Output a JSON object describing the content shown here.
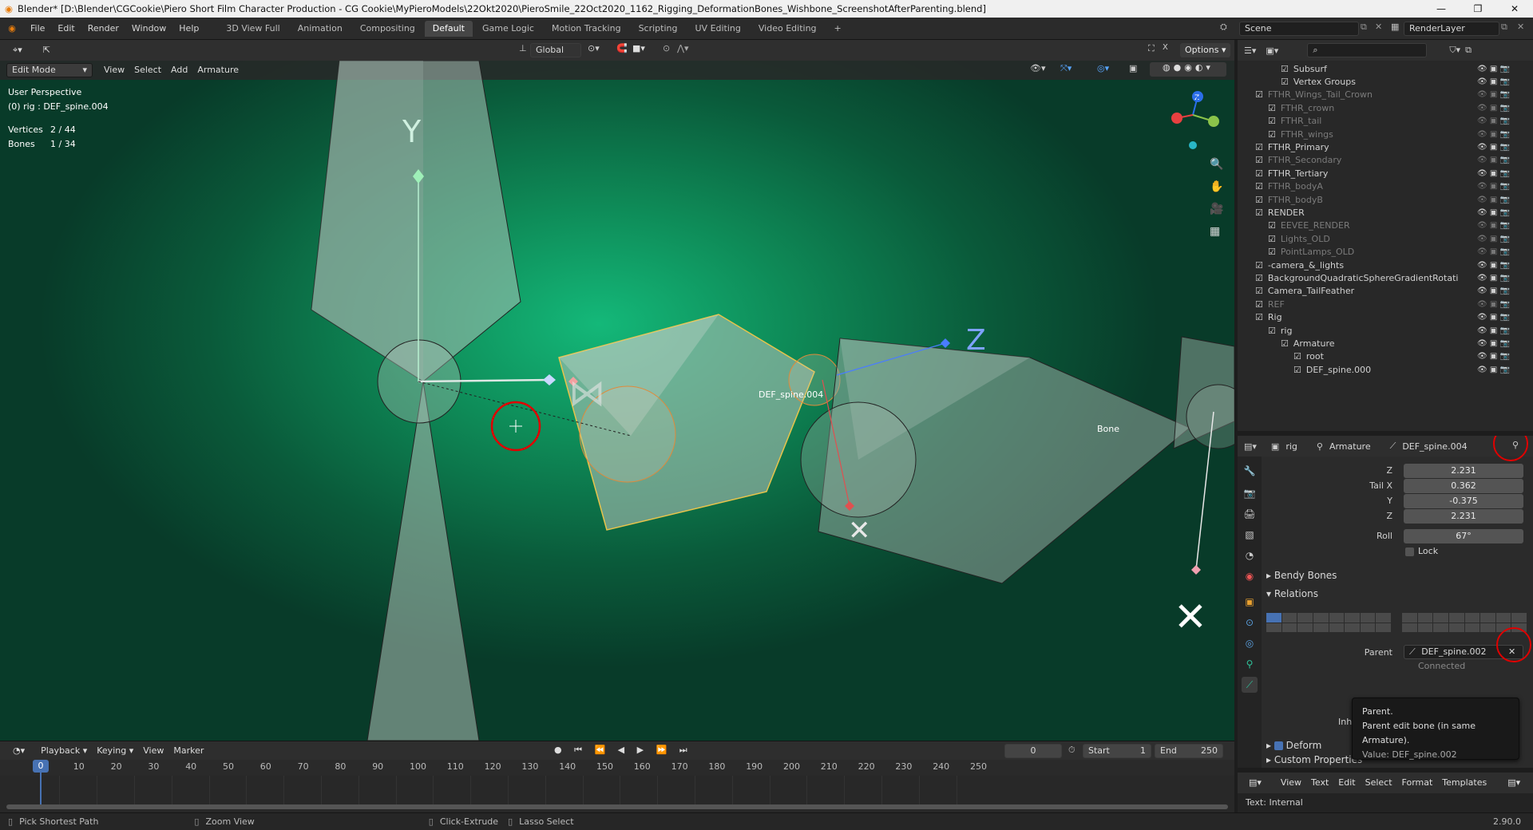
{
  "window": {
    "title": "Blender* [D:\\Blender\\CGCookie\\Piero Short Film Character Production - CG Cookie\\MyPieroModels\\22Okt2020\\PieroSmile_22Oct2020_1162_Rigging_DeformationBones_Wishbone_ScreenshotAfterParenting.blend]",
    "controls": {
      "minimize": "—",
      "maximize": "❐",
      "close": "✕"
    }
  },
  "menu": {
    "items": [
      "File",
      "Edit",
      "Render",
      "Window",
      "Help"
    ]
  },
  "workspaces": {
    "tabs": [
      "3D View Full",
      "Animation",
      "Compositing",
      "Default",
      "Game Logic",
      "Motion Tracking",
      "Scripting",
      "UV Editing",
      "Video Editing"
    ],
    "active": "Default",
    "add": "+"
  },
  "scene": {
    "name": "Scene",
    "render_layer": "RenderLayer"
  },
  "viewport_header": {
    "orientation": "Global",
    "options": "Options"
  },
  "viewport_tool_header": {
    "mode": "Edit Mode",
    "menus": [
      "View",
      "Select",
      "Add",
      "Armature"
    ]
  },
  "viewport": {
    "perspective": "User Perspective",
    "object": "(0) rig : DEF_spine.004",
    "vertices_label": "Vertices",
    "vertices_value": "2 / 44",
    "bones_label": "Bones",
    "bones_value": "1 / 34",
    "bone_label_active": "DEF_spine.004",
    "bone_label_other": "Bone",
    "axis_y": "Y",
    "axis_z": "Z",
    "gizmo": {
      "z": "Z",
      "y": "Y",
      "x": "X"
    }
  },
  "timeline": {
    "menus": [
      "Playback",
      "Keying",
      "View",
      "Marker"
    ],
    "current_frame": "0",
    "start_label": "Start",
    "start_value": "1",
    "end_label": "End",
    "end_value": "250",
    "ticks": [
      "0",
      "10",
      "20",
      "30",
      "40",
      "50",
      "60",
      "70",
      "80",
      "90",
      "100",
      "110",
      "120",
      "130",
      "140",
      "150",
      "160",
      "170",
      "180",
      "190",
      "200",
      "210",
      "220",
      "230",
      "240",
      "250"
    ]
  },
  "status": {
    "items": [
      "Pick Shortest Path",
      "Zoom View",
      "Click-Extrude",
      "Lasso Select"
    ],
    "version": "2.90.0"
  },
  "outliner": {
    "rows": [
      {
        "name": "Subsurf",
        "dim": false
      },
      {
        "name": "Vertex Groups",
        "dim": false
      },
      {
        "name": "FTHR_Wings_Tail_Crown",
        "dim": true
      },
      {
        "name": "FTHR_crown",
        "dim": true
      },
      {
        "name": "FTHR_tail",
        "dim": true
      },
      {
        "name": "FTHR_wings",
        "dim": true
      },
      {
        "name": "FTHR_Primary",
        "dim": false
      },
      {
        "name": "FTHR_Secondary",
        "dim": true
      },
      {
        "name": "FTHR_Tertiary",
        "dim": false
      },
      {
        "name": "FTHR_bodyA",
        "dim": true
      },
      {
        "name": "FTHR_bodyB",
        "dim": true
      },
      {
        "name": "RENDER",
        "dim": false
      },
      {
        "name": "EEVEE_RENDER",
        "dim": true
      },
      {
        "name": "Lights_OLD",
        "dim": true
      },
      {
        "name": "PointLamps_OLD",
        "dim": true
      },
      {
        "name": "-camera_&_lights",
        "dim": false
      },
      {
        "name": "BackgroundQuadraticSphereGradientRotati",
        "dim": false
      },
      {
        "name": "Camera_TailFeather",
        "dim": false
      },
      {
        "name": "REF",
        "dim": true
      },
      {
        "name": "Rig",
        "dim": false
      },
      {
        "name": "rig",
        "dim": false
      },
      {
        "name": "Armature",
        "dim": false
      },
      {
        "name": "root",
        "dim": false
      },
      {
        "name": "DEF_spine.000",
        "dim": false
      }
    ]
  },
  "properties": {
    "breadcrumb": [
      "rig",
      "Armature",
      "DEF_spine.004"
    ],
    "fields": {
      "z_label": "Z",
      "z_value": "2.231",
      "tailx_label": "Tail X",
      "tailx_value": "0.362",
      "taily_label": "Y",
      "taily_value": "-0.375",
      "tailz_label": "Z",
      "tailz_value": "2.231",
      "roll_label": "Roll",
      "roll_value": "67°",
      "lock_label": "Lock"
    },
    "sections": {
      "bendy": "Bendy Bones",
      "relations": "Relations",
      "deform": "Deform",
      "custom": "Custom Properties"
    },
    "parent_label": "Parent",
    "parent_value": "DEF_spine.002",
    "connected_label": "Connected",
    "inherit_label": "Inherit Sca"
  },
  "tooltip": {
    "title": "Parent.",
    "description": "Parent edit bone (in same Armature).",
    "value": "Value: DEF_spine.002"
  },
  "text_editor": {
    "menus": [
      "View",
      "Text",
      "Edit",
      "Select",
      "Format",
      "Templates"
    ],
    "body": "Text: Internal"
  },
  "colors": {
    "accent_blue": "#4772b3",
    "annotation_red": "#e00000",
    "selected_bone": "#e8c44a"
  }
}
